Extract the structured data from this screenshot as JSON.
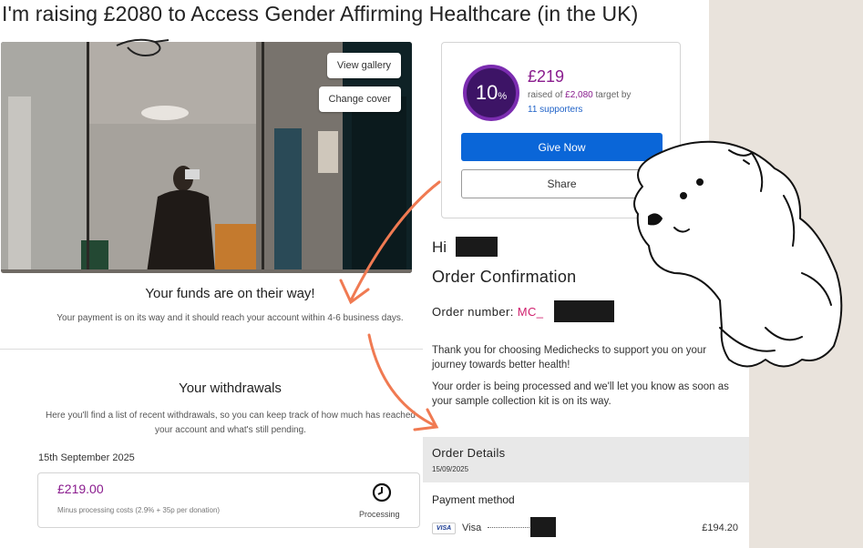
{
  "fundraiser": {
    "title": "I'm raising £2080 to Access Gender Affirming Healthcare (in the UK)",
    "cover_buttons": {
      "view_gallery": "View gallery",
      "change_cover": "Change cover"
    },
    "progress": {
      "percent": "10",
      "percent_sign": "%",
      "raised": "£219",
      "raised_prefix": "raised of ",
      "target": "£2,080",
      "target_suffix": " target by",
      "supporters": "11 supporters"
    },
    "give_now_label": "Give Now",
    "share_label": "Share"
  },
  "funds": {
    "title": "Your funds are on their way!",
    "description": "Your payment is on its way and it should reach your account within 4-6 business days."
  },
  "withdrawals": {
    "title": "Your withdrawals",
    "description": "Here you'll find a list of recent withdrawals, so you can keep track of how much has reached your account and what's still pending.",
    "date": "15th September 2025",
    "amount": "£219.00",
    "note": "Minus processing costs (2.9% + 35p per donation)",
    "status": "Processing",
    "status_icon": "clock-icon"
  },
  "email": {
    "greeting": "Hi",
    "title": "Order Confirmation",
    "order_label": "Order number: ",
    "order_value": "MC_",
    "paragraph_1": "Thank you for choosing Medichecks to support you on your journey towards better health!",
    "paragraph_2": "Your order is being processed and we'll let you know as soon as your sample collection kit is on its way.",
    "order_details_title": "Order Details",
    "order_date": "15/09/2025",
    "payment_method_title": "Payment method",
    "card_brand": "VISA",
    "card_label": "Visa",
    "payment_amount": "£194.20"
  },
  "colors": {
    "accent_purple": "#8a1c8e",
    "give_blue": "#0a66d8",
    "link_blue": "#2163c8",
    "order_pink": "#d0206e",
    "arrow_orange": "#f07a52",
    "background": "#e9e3dc"
  }
}
